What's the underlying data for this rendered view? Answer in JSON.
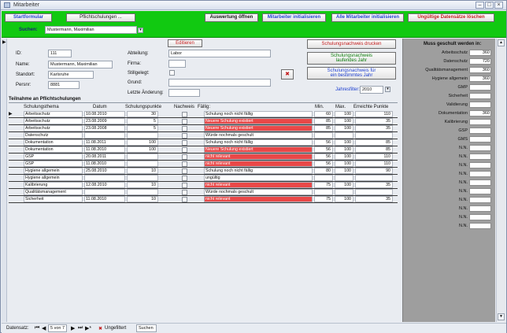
{
  "window": {
    "title": "Mitarbeiter"
  },
  "header": {
    "buttons": [
      "Startformular",
      "Pflichtschulungen ...",
      "Auswertung öffnen",
      "Mitarbeiter initialisieren",
      "Alle Mitarbeiter initialisieren",
      "Ungültige Datensätze löschen"
    ],
    "search_label": "Suchen:",
    "search_value": "Mustermann, Maximilian"
  },
  "form": {
    "edit_button": "Editieren",
    "id_label": "ID:",
    "id_value": "111",
    "name_label": "Name:",
    "name_value": "Mustermann, Maximilian",
    "standort_label": "Standort:",
    "standort_value": "Karlsruhe",
    "persnr_label": "Persnr:",
    "persnr_value": "8881",
    "abteilung_label": "Abteilung:",
    "abteilung_value": "Labor",
    "firma_label": "Firma:",
    "firma_value": "",
    "stillgelegt_label": "Stillgelegt:",
    "grund_label": "Grund:",
    "grund_value": "",
    "letzte_label": "Letzte Änderung:",
    "letzte_value": "",
    "btn_druck": "Schulungsnachweis drucken",
    "btn_laufend_1": "Schulungsnachweis",
    "btn_laufend_2": "laufendes Jahr",
    "btn_jahr_1": "Schulungsnachweis für",
    "btn_jahr_2": "ein bestimmtes Jahr",
    "jahresfilter_label": "Jahresfilter:",
    "jahresfilter_value": "2010"
  },
  "table": {
    "title": "Teilnahme an Pflichtschulungen",
    "headers": [
      "Schulungsthema",
      "Datum",
      "Schulungspunkte",
      "Nachweis",
      "Fällig:",
      "Min.",
      "Max.",
      "Erreichte Punkte"
    ],
    "rows": [
      {
        "thema": "Arbeitsschutz",
        "datum": "10.08.2010",
        "punkte": "30",
        "faellig": "Schulung noch nicht fällig",
        "min": "60",
        "max": "100",
        "erreicht": "110",
        "color": "#fff"
      },
      {
        "thema": "Arbeitsschutz",
        "datum": "23.08.2009",
        "punkte": "5",
        "faellig": "Neuere Schulung existiert",
        "min": "85",
        "max": "100",
        "erreicht": "35",
        "color": "#e94848"
      },
      {
        "thema": "Arbeitsschutz",
        "datum": "23.08.2008",
        "punkte": "5",
        "faellig": "Neuere Schulung existiert",
        "min": "85",
        "max": "100",
        "erreicht": "35",
        "color": "#e94848"
      },
      {
        "thema": "Datenschutz",
        "datum": "",
        "punkte": "",
        "faellig": "Würde nochmals geschult",
        "min": "",
        "max": "",
        "erreicht": "",
        "color": "#fff"
      },
      {
        "thema": "Dokumentation",
        "datum": "11.08.2011",
        "punkte": "100",
        "faellig": "Schulung noch nicht fällig",
        "min": "56",
        "max": "100",
        "erreicht": "85",
        "color": "#fff"
      },
      {
        "thema": "Dokumentation",
        "datum": "11.08.2010",
        "punkte": "100",
        "faellig": "Neuere Schulung existiert",
        "min": "56",
        "max": "100",
        "erreicht": "85",
        "color": "#e94848"
      },
      {
        "thema": "GSP",
        "datum": "20.08.2011",
        "punkte": "",
        "faellig": "nicht relevant",
        "min": "56",
        "max": "100",
        "erreicht": "110",
        "color": "#e94848"
      },
      {
        "thema": "GSP",
        "datum": "11.08.2010",
        "punkte": "",
        "faellig": "nicht relevant",
        "min": "56",
        "max": "100",
        "erreicht": "110",
        "color": "#e94848"
      },
      {
        "thema": "Hygiene allgemein",
        "datum": "25.08.2010",
        "punkte": "10",
        "faellig": "Schulung noch nicht fällig",
        "min": "80",
        "max": "100",
        "erreicht": "90",
        "color": "#fff"
      },
      {
        "thema": "Hygiene allgemein",
        "datum": "",
        "punkte": "",
        "faellig": "ungültig",
        "min": "",
        "max": "",
        "erreicht": "",
        "color": "#fff"
      },
      {
        "thema": "Kalibrierung",
        "datum": "12.08.2010",
        "punkte": "10",
        "faellig": "nicht relevant",
        "min": "75",
        "max": "100",
        "erreicht": "35",
        "color": "#e94848"
      },
      {
        "thema": "Qualitätsmanagement",
        "datum": "",
        "punkte": "",
        "faellig": "Würde nochmals geschult",
        "min": "",
        "max": "",
        "erreicht": "",
        "color": "#fff"
      },
      {
        "thema": "Sicherheit",
        "datum": "11.08.2010",
        "punkte": "10",
        "faellig": "nicht relevant",
        "min": "75",
        "max": "100",
        "erreicht": "35",
        "color": "#e94848"
      }
    ]
  },
  "right_panel": {
    "title": "Muss geschult werden in:",
    "items": [
      {
        "label": "Arbeitsschutz",
        "value": "360"
      },
      {
        "label": "Datenschutz",
        "value": "720"
      },
      {
        "label": "Qualitätsmanagement",
        "value": "360"
      },
      {
        "label": "Hygiene allgemein",
        "value": "360"
      },
      {
        "label": "GMP",
        "value": ""
      },
      {
        "label": "Sicherheit",
        "value": ""
      },
      {
        "label": "Validierung",
        "value": ""
      },
      {
        "label": "Dokumentation",
        "value": "360"
      },
      {
        "label": "Kalibrierung",
        "value": ""
      },
      {
        "label": "GSP",
        "value": ""
      },
      {
        "label": "GMS",
        "value": ""
      },
      {
        "label": "N.N.",
        "value": ""
      },
      {
        "label": "N.N.",
        "value": ""
      },
      {
        "label": "N.N.",
        "value": ""
      },
      {
        "label": "N.N.",
        "value": ""
      },
      {
        "label": "N.N.",
        "value": ""
      },
      {
        "label": "N.N.",
        "value": ""
      },
      {
        "label": "N.N.",
        "value": ""
      },
      {
        "label": "N.N.",
        "value": ""
      },
      {
        "label": "N.N.",
        "value": ""
      },
      {
        "label": "N.N.",
        "value": ""
      }
    ]
  },
  "status": {
    "label": "Datensatz:",
    "record": "5 von 7",
    "filter": "Ungefiltert",
    "search": "Suchen"
  },
  "colors": {
    "header_green": "#11c911",
    "red_row": "#e94848"
  }
}
